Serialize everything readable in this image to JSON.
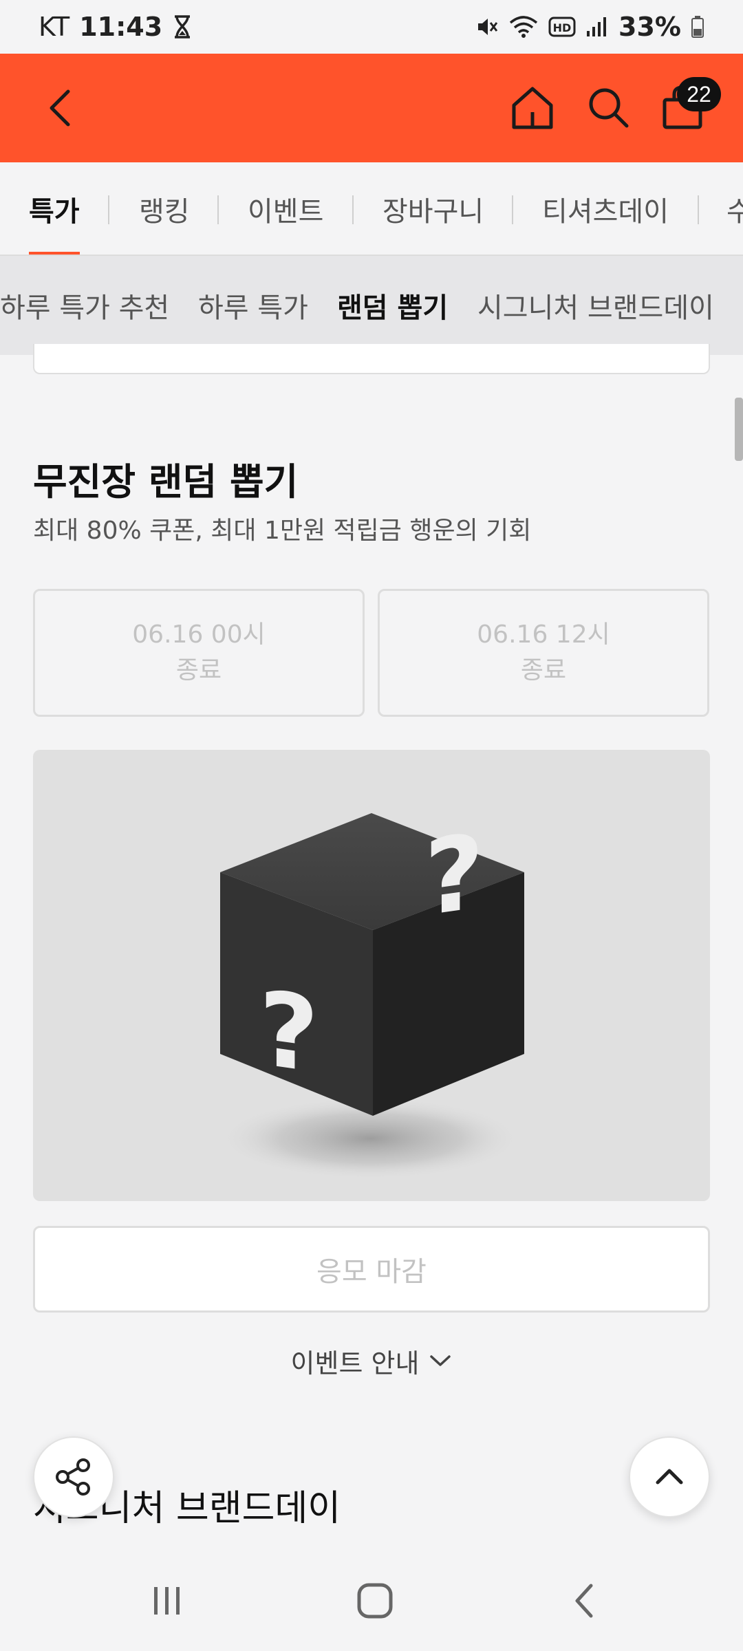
{
  "status_bar": {
    "carrier": "KT",
    "time": "11:43",
    "battery": "33%",
    "icons": [
      "hourglass-icon",
      "mute-icon",
      "wifi-icon",
      "hd-icon",
      "signal-icon",
      "battery-icon"
    ]
  },
  "header": {
    "cart_count": "22",
    "icons": [
      "back-icon",
      "home-icon",
      "search-icon",
      "cart-icon"
    ],
    "accent_color": "#ff532b"
  },
  "main_tabs": [
    {
      "label": "특가",
      "active": true
    },
    {
      "label": "랭킹",
      "active": false
    },
    {
      "label": "이벤트",
      "active": false
    },
    {
      "label": "장바구니",
      "active": false
    },
    {
      "label": "티셔츠데이",
      "active": false
    },
    {
      "label": "수",
      "active": false
    }
  ],
  "sub_tabs": [
    {
      "label": "하루 특가 추천",
      "active": false
    },
    {
      "label": "하루 특가",
      "active": false
    },
    {
      "label": "랜덤 뽑기",
      "active": true
    },
    {
      "label": "시그니처 브랜드데이",
      "active": false
    }
  ],
  "section": {
    "title": "무진장 랜덤 뽑기",
    "subtitle": "최대 80% 쿠폰, 최대 1만원 적립금 행운의 기회"
  },
  "rounds": [
    {
      "time": "06.16 00시",
      "status": "종료"
    },
    {
      "time": "06.16 12시",
      "status": "종료"
    }
  ],
  "apply_button": "응모 마감",
  "event_info": "이벤트 안내",
  "next_section_title": "시그니처 브랜드데이",
  "fabs": [
    "share-icon",
    "chevron-up-icon"
  ],
  "nav_bar": [
    "recents-icon",
    "home-icon",
    "back-icon"
  ]
}
